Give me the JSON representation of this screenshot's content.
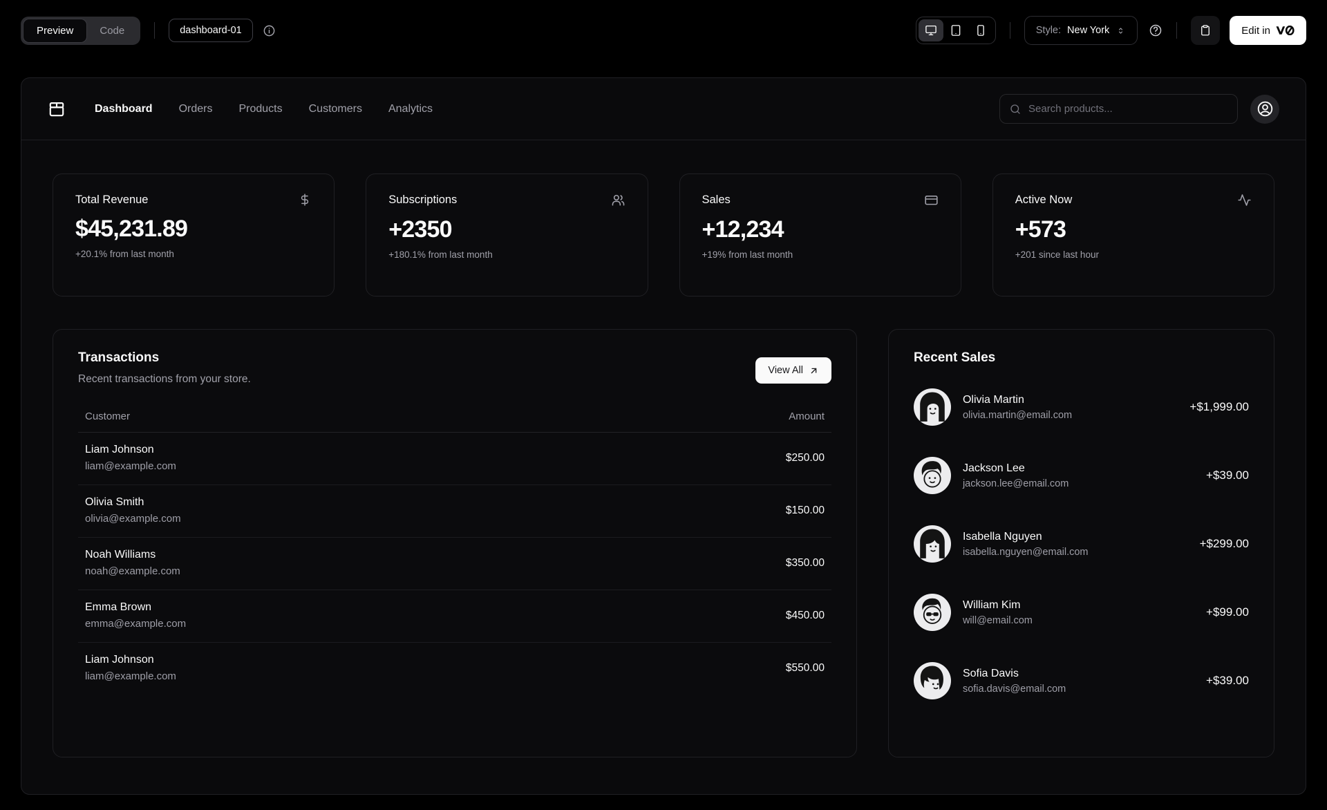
{
  "toolbar": {
    "view_toggle": {
      "preview_label": "Preview",
      "code_label": "Code"
    },
    "block_name": "dashboard-01",
    "info_icon": "info-circle-icon",
    "device_icons": [
      "desktop-icon",
      "tablet-icon",
      "smartphone-icon"
    ],
    "style_label": "Style:",
    "style_value": "New York",
    "help_icon": "help-circle-icon",
    "clipboard_icon": "clipboard-icon",
    "edit_button_label": "Edit in",
    "edit_button_logo": "v0"
  },
  "navbar": {
    "brand_icon": "package-icon",
    "links": [
      {
        "label": "Dashboard",
        "active": true
      },
      {
        "label": "Orders",
        "active": false
      },
      {
        "label": "Products",
        "active": false
      },
      {
        "label": "Customers",
        "active": false
      },
      {
        "label": "Analytics",
        "active": false
      }
    ],
    "search_placeholder": "Search products...",
    "user_icon": "user-circle-icon"
  },
  "stats": [
    {
      "title": "Total Revenue",
      "icon": "dollar-sign-icon",
      "value": "$45,231.89",
      "change": "+20.1% from last month"
    },
    {
      "title": "Subscriptions",
      "icon": "users-icon",
      "value": "+2350",
      "change": "+180.1% from last month"
    },
    {
      "title": "Sales",
      "icon": "credit-card-icon",
      "value": "+12,234",
      "change": "+19% from last month"
    },
    {
      "title": "Active Now",
      "icon": "activity-icon",
      "value": "+573",
      "change": "+201 since last hour"
    }
  ],
  "transactions": {
    "title": "Transactions",
    "description": "Recent transactions from your store.",
    "view_all_label": "View All",
    "view_all_icon": "arrow-up-right-icon",
    "columns": {
      "customer": "Customer",
      "amount": "Amount"
    },
    "rows": [
      {
        "name": "Liam Johnson",
        "email": "liam@example.com",
        "amount": "$250.00"
      },
      {
        "name": "Olivia Smith",
        "email": "olivia@example.com",
        "amount": "$150.00"
      },
      {
        "name": "Noah Williams",
        "email": "noah@example.com",
        "amount": "$350.00"
      },
      {
        "name": "Emma Brown",
        "email": "emma@example.com",
        "amount": "$450.00"
      },
      {
        "name": "Liam Johnson",
        "email": "liam@example.com",
        "amount": "$550.00"
      }
    ]
  },
  "recent_sales": {
    "title": "Recent Sales",
    "items": [
      {
        "name": "Olivia Martin",
        "email": "olivia.martin@email.com",
        "amount": "+$1,999.00"
      },
      {
        "name": "Jackson Lee",
        "email": "jackson.lee@email.com",
        "amount": "+$39.00"
      },
      {
        "name": "Isabella Nguyen",
        "email": "isabella.nguyen@email.com",
        "amount": "+$299.00"
      },
      {
        "name": "William Kim",
        "email": "will@email.com",
        "amount": "+$99.00"
      },
      {
        "name": "Sofia Davis",
        "email": "sofia.davis@email.com",
        "amount": "+$39.00"
      }
    ]
  },
  "colors": {
    "page_background": "#000000",
    "surface": "#0b0b0d",
    "border": "#202024",
    "text_primary": "#fafafa",
    "text_muted": "#a1a1aa",
    "primary_button": "#ffffff"
  }
}
